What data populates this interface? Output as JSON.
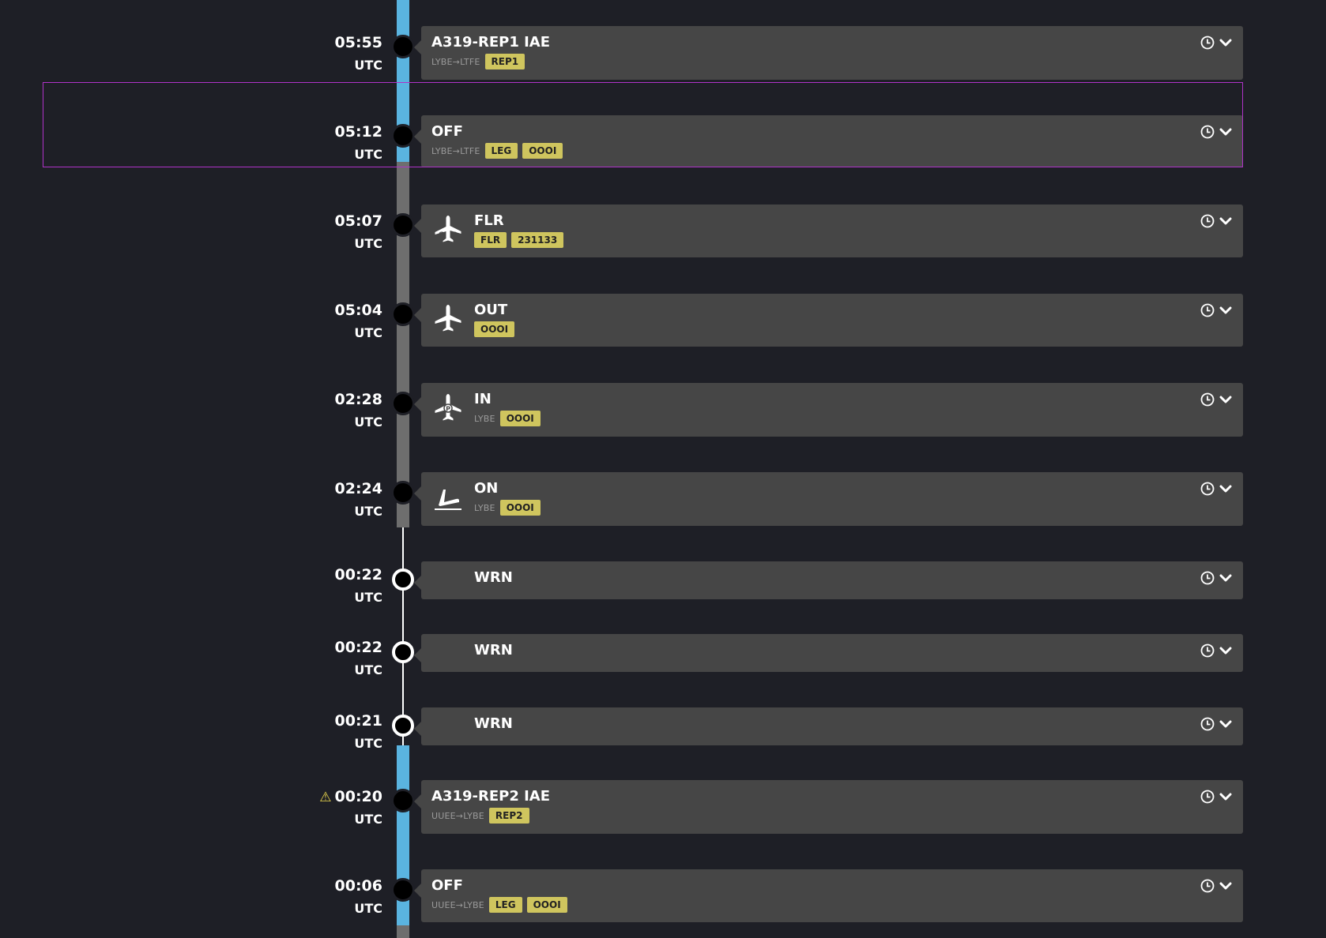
{
  "events": [
    {
      "time": "05:55",
      "tz": "UTC",
      "title": "A319-REP1 IAE",
      "route": "LYBE→LTFE",
      "tags": [
        "REP1"
      ],
      "icon": null,
      "warning": false
    },
    {
      "time": "05:12",
      "tz": "UTC",
      "title": "OFF",
      "route": "LYBE→LTFE",
      "tags": [
        "LEG",
        "OOOI"
      ],
      "icon": null,
      "warning": false
    },
    {
      "time": "05:07",
      "tz": "UTC",
      "title": "FLR",
      "route": "",
      "tags": [
        "FLR",
        "231133"
      ],
      "icon": "airplane-flr-icon",
      "warning": false
    },
    {
      "time": "05:04",
      "tz": "UTC",
      "title": "OUT",
      "route": "",
      "tags": [
        "OOOI"
      ],
      "icon": "airplane-out-icon",
      "warning": false
    },
    {
      "time": "02:28",
      "tz": "UTC",
      "title": "IN",
      "route": "LYBE",
      "tags": [
        "OOOI"
      ],
      "icon": "airplane-parked-icon",
      "warning": false
    },
    {
      "time": "02:24",
      "tz": "UTC",
      "title": "ON",
      "route": "LYBE",
      "tags": [
        "OOOI"
      ],
      "icon": "airplane-landing-icon",
      "warning": false
    },
    {
      "time": "00:22",
      "tz": "UTC",
      "title": "WRN",
      "route": "",
      "tags": [],
      "icon": null,
      "warning": false
    },
    {
      "time": "00:22",
      "tz": "UTC",
      "title": "WRN",
      "route": "",
      "tags": [],
      "icon": null,
      "warning": false
    },
    {
      "time": "00:21",
      "tz": "UTC",
      "title": "WRN",
      "route": "",
      "tags": [],
      "icon": null,
      "warning": false
    },
    {
      "time": "00:20",
      "tz": "UTC",
      "title": "A319-REP2 IAE",
      "route": "UUEE→LYBE",
      "tags": [
        "REP2"
      ],
      "icon": null,
      "warning": true,
      "warning_glyph": "⚠"
    },
    {
      "time": "00:06",
      "tz": "UTC",
      "title": "OFF",
      "route": "UUEE→LYBE",
      "tags": [
        "LEG",
        "OOOI"
      ],
      "icon": null,
      "warning": false
    }
  ],
  "colors": {
    "background": "#1e1f26",
    "card": "#464646",
    "tag": "#cfc55e",
    "rail_active": "#5ab4e0",
    "rail_inactive": "#6e6e6e",
    "selection": "#b033c8",
    "warning": "#e8d44d"
  }
}
